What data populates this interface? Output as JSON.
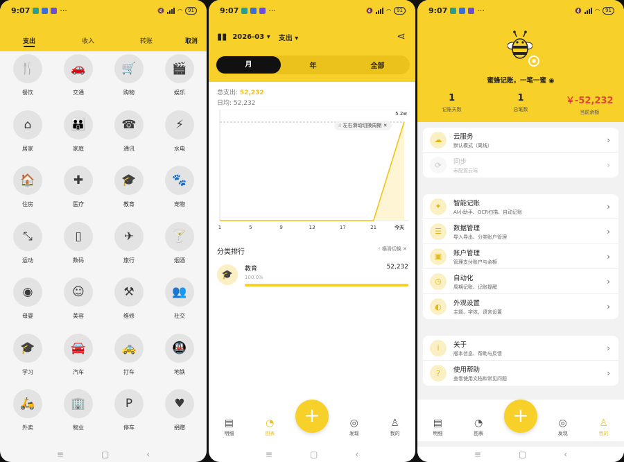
{
  "status": {
    "time": "9:07",
    "battery": "91"
  },
  "category": {
    "tabs": [
      "支出",
      "收入",
      "转账"
    ],
    "cancel": "取消",
    "items": [
      {
        "label": "餐饮",
        "glyph": "🍴",
        "icon": "utensils-icon"
      },
      {
        "label": "交通",
        "glyph": "🚗",
        "icon": "car-icon"
      },
      {
        "label": "购物",
        "glyph": "🛒",
        "icon": "cart-icon"
      },
      {
        "label": "娱乐",
        "glyph": "🎬",
        "icon": "clapperboard-icon"
      },
      {
        "label": "居家",
        "glyph": "⌂",
        "icon": "home-icon"
      },
      {
        "label": "家庭",
        "glyph": "👪",
        "icon": "family-icon"
      },
      {
        "label": "通讯",
        "glyph": "☎",
        "icon": "phone-icon"
      },
      {
        "label": "水电",
        "glyph": "⚡",
        "icon": "bolt-icon"
      },
      {
        "label": "住房",
        "glyph": "🏠",
        "icon": "house-icon"
      },
      {
        "label": "医疗",
        "glyph": "✚",
        "icon": "medical-icon"
      },
      {
        "label": "教育",
        "glyph": "🎓",
        "icon": "graduation-cap-icon"
      },
      {
        "label": "宠物",
        "glyph": "🐾",
        "icon": "paw-icon"
      },
      {
        "label": "运动",
        "glyph": "⤡",
        "icon": "fitness-icon"
      },
      {
        "label": "数码",
        "glyph": "▯",
        "icon": "device-icon"
      },
      {
        "label": "旅行",
        "glyph": "✈",
        "icon": "airplane-icon"
      },
      {
        "label": "烟酒",
        "glyph": "🍸",
        "icon": "cocktail-icon"
      },
      {
        "label": "母婴",
        "glyph": "◉",
        "icon": "baby-icon"
      },
      {
        "label": "美容",
        "glyph": "☺",
        "icon": "face-icon"
      },
      {
        "label": "维修",
        "glyph": "⚒",
        "icon": "tools-icon"
      },
      {
        "label": "社交",
        "glyph": "👥",
        "icon": "people-icon"
      },
      {
        "label": "学习",
        "glyph": "🎓",
        "icon": "study-icon"
      },
      {
        "label": "汽车",
        "glyph": "🚘",
        "icon": "automobile-icon"
      },
      {
        "label": "打车",
        "glyph": "🚕",
        "icon": "taxi-icon"
      },
      {
        "label": "地铁",
        "glyph": "🚇",
        "icon": "subway-icon"
      },
      {
        "label": "外卖",
        "glyph": "🛵",
        "icon": "scooter-icon"
      },
      {
        "label": "物业",
        "glyph": "🏢",
        "icon": "building-icon"
      },
      {
        "label": "停车",
        "glyph": "P",
        "icon": "parking-icon"
      },
      {
        "label": "捐赠",
        "glyph": "♥",
        "icon": "donation-icon"
      }
    ]
  },
  "stats": {
    "month": "2026-03",
    "type": "支出",
    "periods": [
      "月",
      "年",
      "全部"
    ],
    "total_label": "总支出:",
    "total_value": "52,232",
    "avg_label": "日均:",
    "avg_value": "52,232",
    "hint": "左右滑动切换周期",
    "max_label": "5.2w",
    "rank_title": "分类排行",
    "rank_switch": "横滑切换",
    "rank_item": {
      "name": "教育",
      "value": "52,232",
      "percent": "100.0%"
    },
    "tabbar": [
      "明细",
      "图表",
      "发现",
      "我的"
    ]
  },
  "chart_data": {
    "type": "line",
    "x": [
      "1",
      "5",
      "9",
      "13",
      "17",
      "21",
      "今天"
    ],
    "values": [
      0,
      0,
      0,
      0,
      0,
      0,
      52232
    ],
    "ylim": [
      0,
      52000
    ],
    "max_tick": "5.2w",
    "color": "#f0c21c"
  },
  "profile": {
    "brand": "蜜蜂记账，一笔一蜜",
    "kpis": [
      {
        "value": "1",
        "label": "记账天数"
      },
      {
        "value": "1",
        "label": "总笔数"
      },
      {
        "value": "￥-52,232",
        "label": "当前余额"
      }
    ],
    "card1": [
      {
        "title": "云服务",
        "sub": "默认模式（离线）",
        "icon": "cloud-icon",
        "glyph": "☁"
      },
      {
        "title": "同步",
        "sub": "未配置云端",
        "icon": "sync-icon",
        "glyph": "⟳"
      }
    ],
    "card2": [
      {
        "title": "智能记账",
        "sub": "AI小助手、OCR扫描、自动记账",
        "icon": "sparkle-icon",
        "glyph": "✦"
      },
      {
        "title": "数据管理",
        "sub": "导入导出、分类账户管理",
        "icon": "data-icon",
        "glyph": "☰"
      },
      {
        "title": "账户管理",
        "sub": "管理支付账户与余额",
        "icon": "wallet-icon",
        "glyph": "▣"
      },
      {
        "title": "自动化",
        "sub": "周期记账、记账提醒",
        "icon": "clock-icon",
        "glyph": "◷"
      },
      {
        "title": "外观设置",
        "sub": "主题、字体、语言设置",
        "icon": "palette-icon",
        "glyph": "◐"
      }
    ],
    "card3": [
      {
        "title": "关于",
        "sub": "版本信息、帮助与反馈",
        "icon": "info-icon",
        "glyph": "i"
      },
      {
        "title": "使用帮助",
        "sub": "查看使用文档和常见问题",
        "icon": "help-icon",
        "glyph": "?"
      }
    ],
    "tabbar": [
      "明细",
      "图表",
      "发现",
      "我的"
    ]
  }
}
